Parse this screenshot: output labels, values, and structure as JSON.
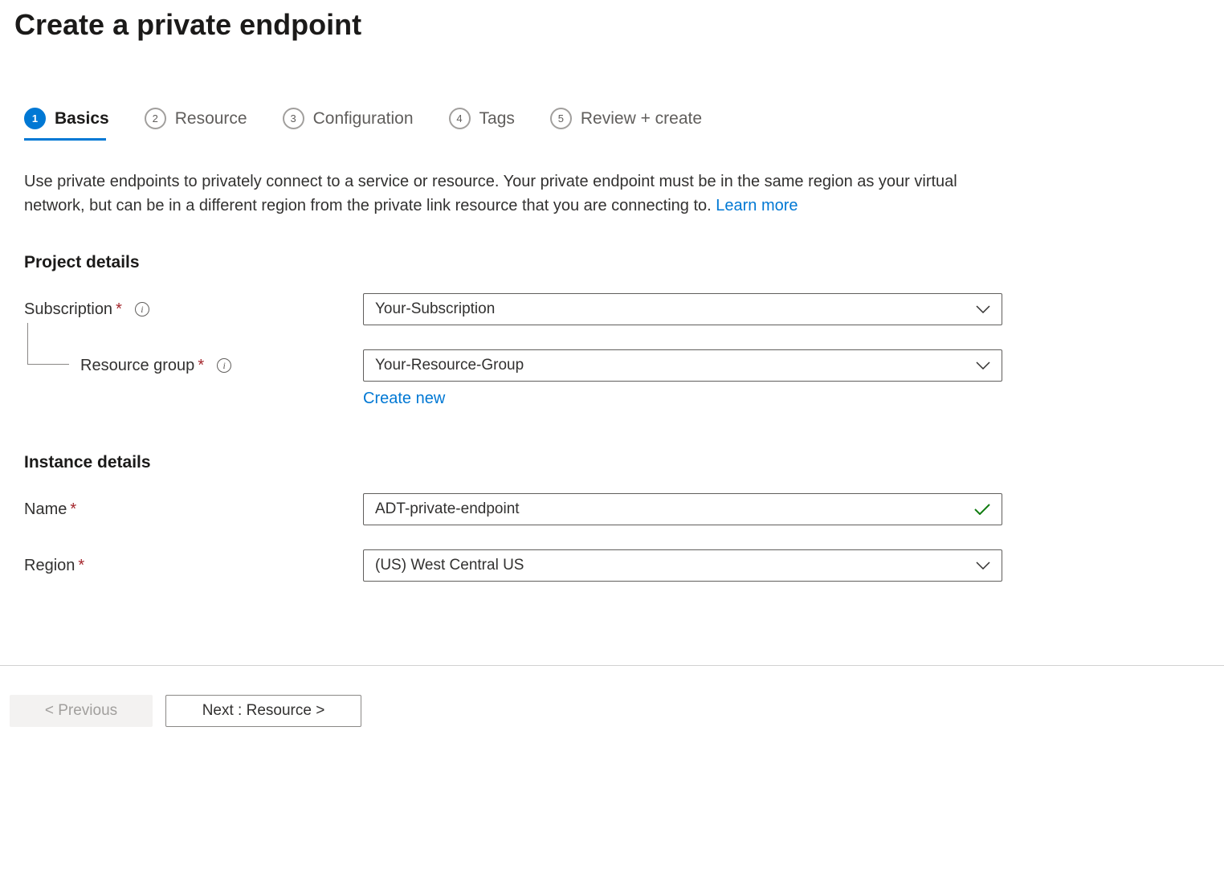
{
  "page_title": "Create a private endpoint",
  "tabs": [
    {
      "number": "1",
      "label": "Basics",
      "active": true
    },
    {
      "number": "2",
      "label": "Resource",
      "active": false
    },
    {
      "number": "3",
      "label": "Configuration",
      "active": false
    },
    {
      "number": "4",
      "label": "Tags",
      "active": false
    },
    {
      "number": "5",
      "label": "Review + create",
      "active": false
    }
  ],
  "description": "Use private endpoints to privately connect to a service or resource. Your private endpoint must be in the same region as your virtual network, but can be in a different region from the private link resource that you are connecting to.  ",
  "learn_more": "Learn more",
  "sections": {
    "project_details": {
      "title": "Project details",
      "subscription_label": "Subscription",
      "subscription_value": "Your-Subscription",
      "resource_group_label": "Resource group",
      "resource_group_value": "Your-Resource-Group",
      "create_new": "Create new"
    },
    "instance_details": {
      "title": "Instance details",
      "name_label": "Name",
      "name_value": "ADT-private-endpoint",
      "region_label": "Region",
      "region_value": "(US) West Central US"
    }
  },
  "footer": {
    "previous_label": "< Previous",
    "next_label": "Next : Resource >"
  }
}
